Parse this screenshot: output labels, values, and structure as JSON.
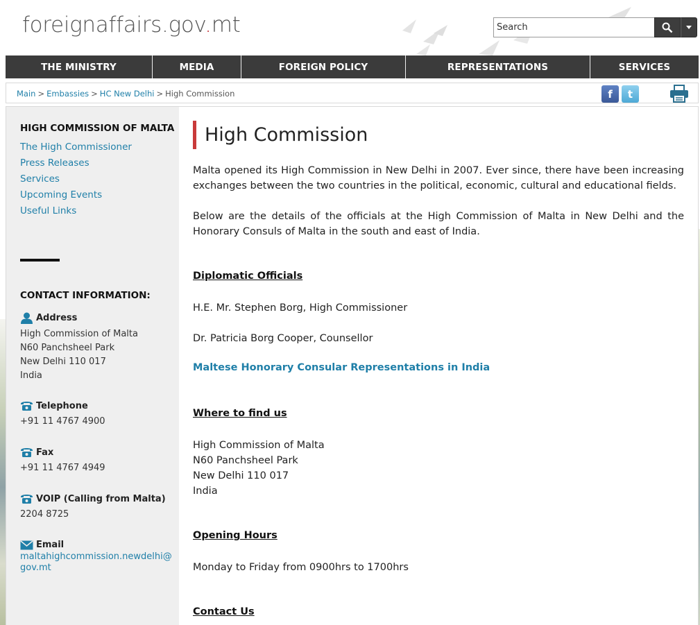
{
  "header": {
    "logo_main": "foreignaffairs.gov",
    "logo_dot": ".",
    "logo_tld": "mt",
    "search_placeholder": "Search"
  },
  "nav": {
    "items": [
      "THE MINISTRY",
      "MEDIA",
      "FOREIGN POLICY",
      "REPRESENTATIONS",
      "SERVICES"
    ]
  },
  "breadcrumb": {
    "items": [
      "Main",
      "Embassies",
      "HC New Delhi"
    ],
    "current": "High Commission",
    "separator": ">"
  },
  "social": {
    "facebook": "f",
    "twitter": "t"
  },
  "sidebar": {
    "title": "HIGH COMMISSION OF MALTA",
    "links": [
      "The High Commissioner",
      "Press Releases",
      "Services",
      "Upcoming Events",
      "Useful Links"
    ],
    "contact_title": "CONTACT INFORMATION:",
    "address_label": "Address",
    "address_lines": [
      "High Commission of Malta",
      "N60 Panchsheel Park",
      "New Delhi 110 017",
      "India"
    ],
    "telephone_label": "Telephone",
    "telephone": "+91 11 4767 4900",
    "fax_label": "Fax",
    "fax": "+91 11 4767 4949",
    "voip_label": "VOIP (Calling from Malta)",
    "voip": "2204 8725",
    "email_label": "Email",
    "email_line1": "maltahighcommission.newdelhi@",
    "email_line2": "gov.mt"
  },
  "content": {
    "title": "High Commission",
    "intro": "Malta opened its High Commission in New Delhi in 2007. Ever since, there have been increasing exchanges between the two countries in the political, economic, cultural and educational fields.",
    "details": "Below are the details of the officials at the High Commission of Malta in New Delhi and the Honorary Consuls of Malta in the south and east of India.",
    "officials_heading": "Diplomatic Officials",
    "official_1": "H.E. Mr. Stephen Borg, High Commissioner",
    "official_2": "Dr. Patricia Borg Cooper, Counsellor",
    "consular_link": "Maltese Honorary Consular Representations in India",
    "find_heading": "Where to find us",
    "find_lines": [
      "High Commission of Malta",
      "N60 Panchsheel Park",
      "New Delhi 110 017",
      "India"
    ],
    "hours_heading": "Opening Hours",
    "hours": "Monday to Friday from 0900hrs to 1700hrs",
    "contact_heading": "Contact Us"
  },
  "colors": {
    "nav_bg": "#3b3b3b",
    "link": "#1f7fa8",
    "title_accent": "#c93a3a",
    "sidebar_bg": "#efefef"
  }
}
